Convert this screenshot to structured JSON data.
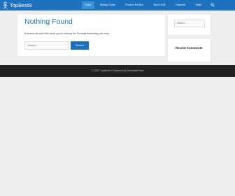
{
  "header": {
    "site_title": "TopBest9",
    "nav": [
      {
        "label": "Home",
        "active": true
      },
      {
        "label": "Beauty Guide",
        "active": false
      },
      {
        "label": "Product Review",
        "active": false
      },
      {
        "label": "Best Of All",
        "active": false
      },
      {
        "label": "Featured",
        "active": false
      },
      {
        "label": "Make",
        "active": false
      }
    ],
    "search_icon": "search-icon"
  },
  "main": {
    "title": "Nothing Found",
    "message": "It seems we can't find what you're looking for. Perhaps searching can help.",
    "search_placeholder": "Search ...",
    "search_button": "Search"
  },
  "sidebar": {
    "search_placeholder": "Search ...",
    "recent_comments_title": "Recent Comments"
  },
  "footer": {
    "text": "© 2022 TopBest9 • Powered by GeneratePress"
  },
  "colors": {
    "brand": "#1e72bd",
    "page_background": "#eeeeee",
    "footer_background": "#222222"
  }
}
